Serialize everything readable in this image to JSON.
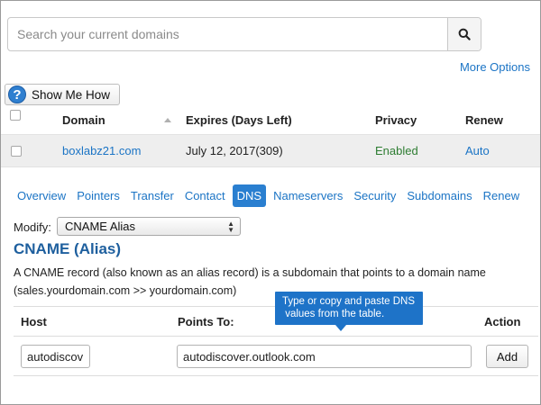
{
  "search": {
    "placeholder": "Search your current domains",
    "value": ""
  },
  "more_options": "More Options",
  "show_me_how": "Show Me How",
  "domains_table": {
    "columns": {
      "domain": "Domain",
      "expires": "Expires (Days Left)",
      "privacy": "Privacy",
      "renew": "Renew"
    },
    "rows": [
      {
        "domain": "boxlabz21.com",
        "expires": "July 12, 2017(309)",
        "privacy": "Enabled",
        "renew": "Auto"
      }
    ]
  },
  "tabs": [
    "Overview",
    "Pointers",
    "Transfer",
    "Contact",
    "DNS",
    "Nameservers",
    "Security",
    "Subdomains",
    "Renew"
  ],
  "active_tab": "DNS",
  "modify": {
    "label": "Modify:",
    "selected": "CNAME Alias"
  },
  "section": {
    "title": "CNAME (Alias)",
    "description_line1": "A CNAME record (also known as an alias record) is a subdomain that points to a domain name",
    "description_line2": "(sales.yourdomain.com >> yourdomain.com)"
  },
  "record_table": {
    "columns": {
      "host": "Host",
      "points_to": "Points To:",
      "action": "Action"
    },
    "host_value": "autodiscov",
    "points_to_value": "autodiscover.outlook.com",
    "add_label": "Add"
  },
  "callout": {
    "line1": "Type or copy and paste DNS",
    "line2": " values from the table."
  },
  "colors": {
    "link": "#1b74c5",
    "accent": "#2a7fd0",
    "title": "#1e5f9e",
    "enabled": "#2e7d32"
  }
}
